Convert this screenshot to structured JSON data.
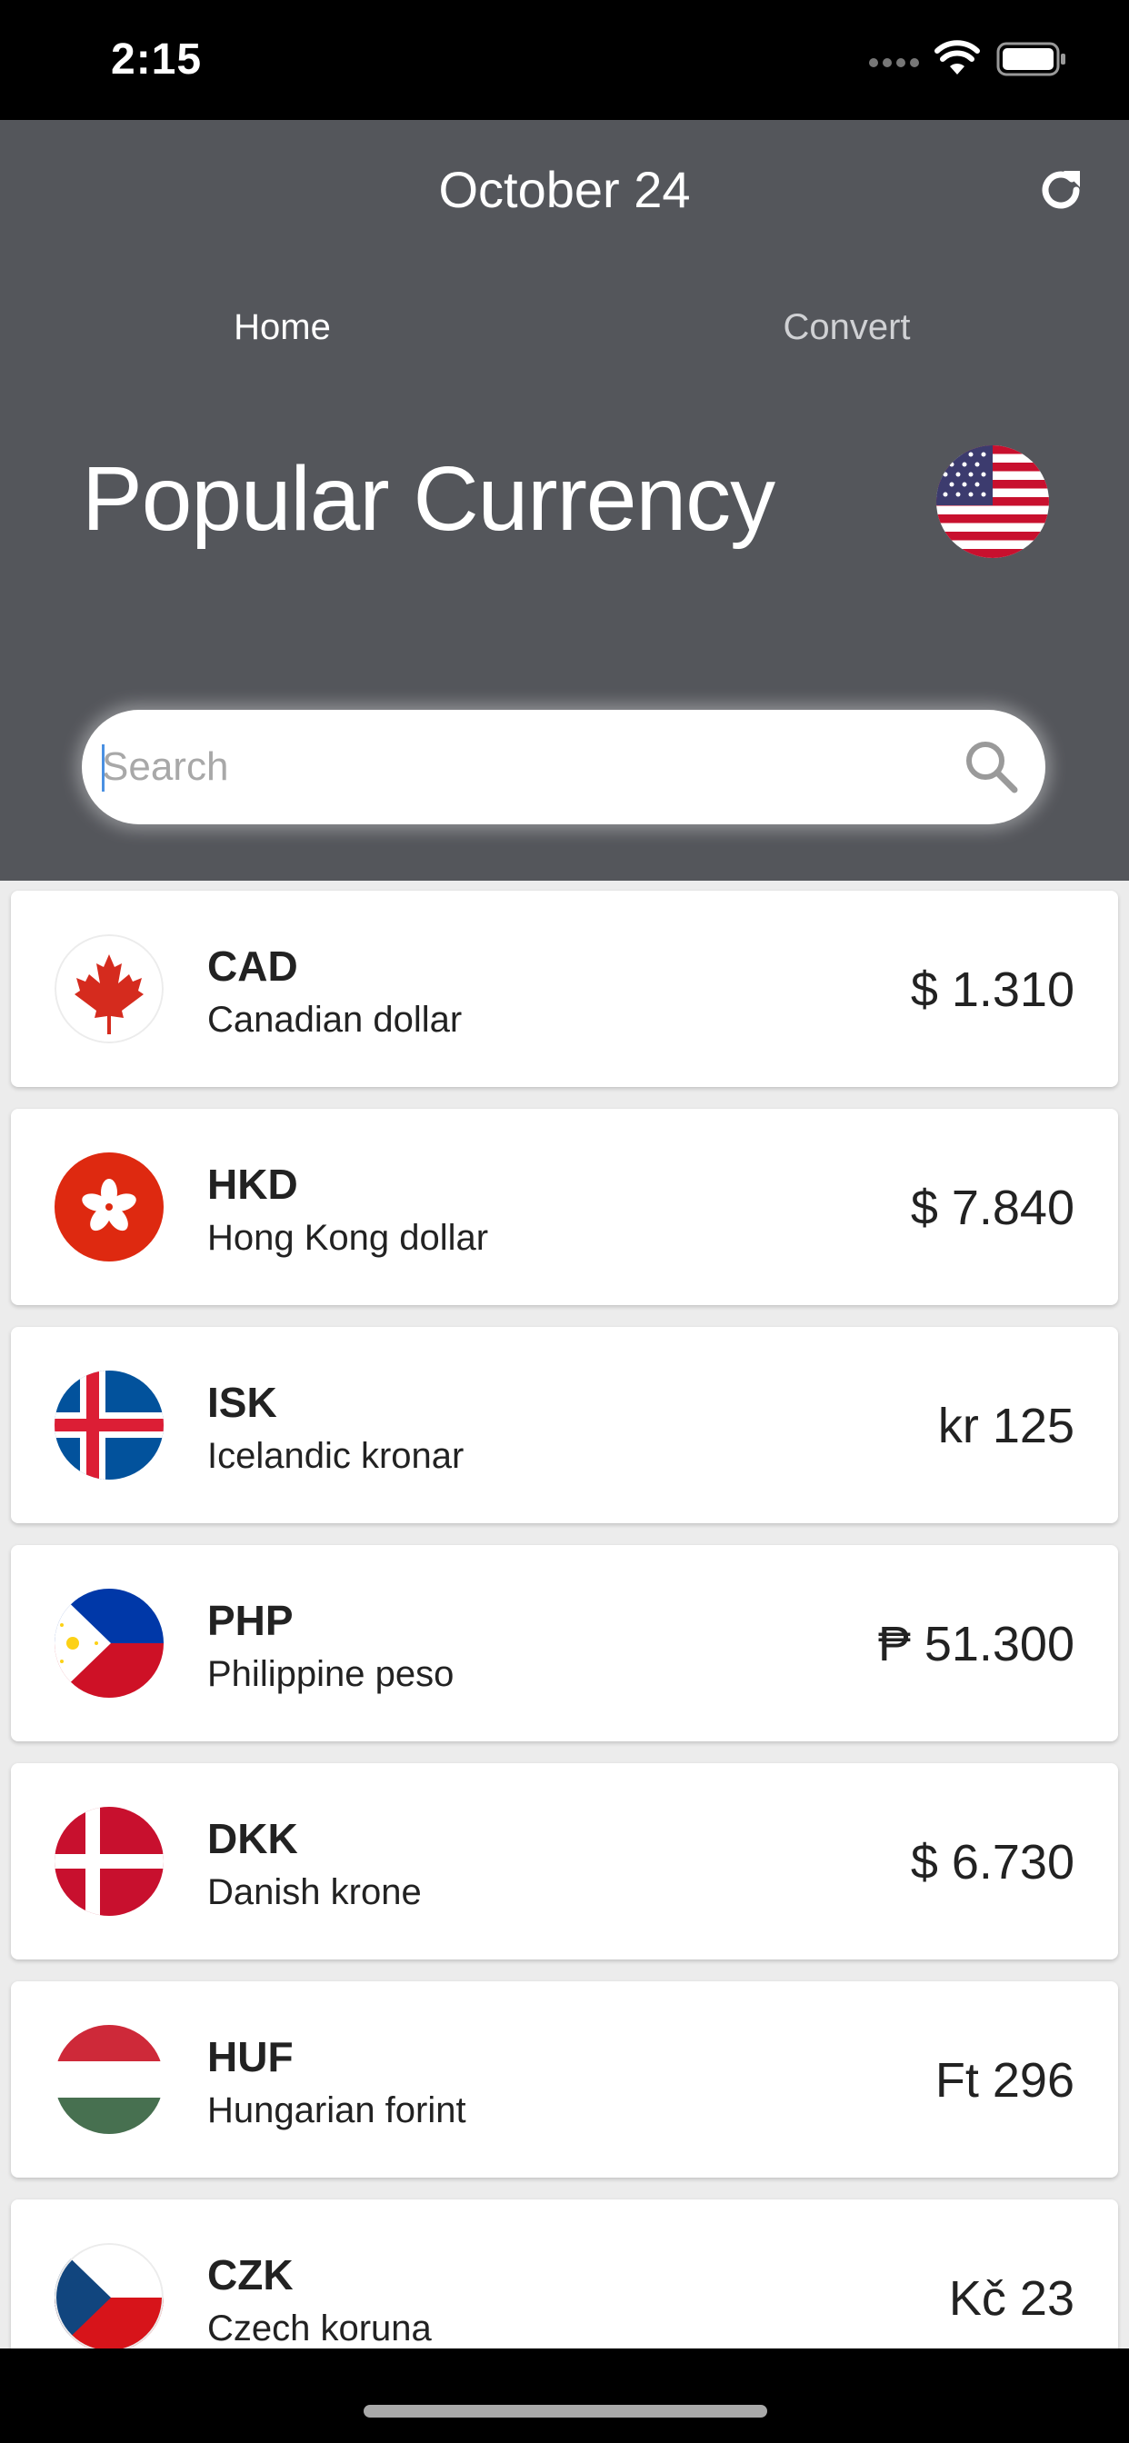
{
  "status_bar": {
    "time": "2:15",
    "icons": [
      "signal-dots-icon",
      "wifi-icon",
      "battery-icon"
    ]
  },
  "header": {
    "date": "October 24",
    "refresh_icon": "refresh-icon"
  },
  "tabs": [
    {
      "label": "Home",
      "active": true
    },
    {
      "label": "Convert",
      "active": false
    }
  ],
  "hero": {
    "title": "Popular Currency",
    "base_flag": "us-flag-icon"
  },
  "search": {
    "placeholder": "Search",
    "value": "",
    "icon": "search-icon"
  },
  "currencies": [
    {
      "code": "CAD",
      "name": "Canadian dollar",
      "rate": "$ 1.310",
      "flag": "canada-flag-icon"
    },
    {
      "code": "HKD",
      "name": "Hong Kong dollar",
      "rate": "$ 7.840",
      "flag": "hong-kong-flag-icon"
    },
    {
      "code": "ISK",
      "name": "Icelandic kronar",
      "rate": "kr 125",
      "flag": "iceland-flag-icon"
    },
    {
      "code": "PHP",
      "name": "Philippine peso",
      "rate": "₱ 51.300",
      "flag": "philippines-flag-icon"
    },
    {
      "code": "DKK",
      "name": "Danish krone",
      "rate": "$ 6.730",
      "flag": "denmark-flag-icon"
    },
    {
      "code": "HUF",
      "name": "Hungarian forint",
      "rate": "Ft 296",
      "flag": "hungary-flag-icon"
    },
    {
      "code": "CZK",
      "name": "Czech koruna",
      "rate": "Kč 23",
      "flag": "czech-flag-icon"
    }
  ],
  "colors": {
    "header_bg": "#54565b",
    "status_bg": "#000000",
    "card_bg": "#ffffff",
    "list_bg": "#ececec"
  }
}
